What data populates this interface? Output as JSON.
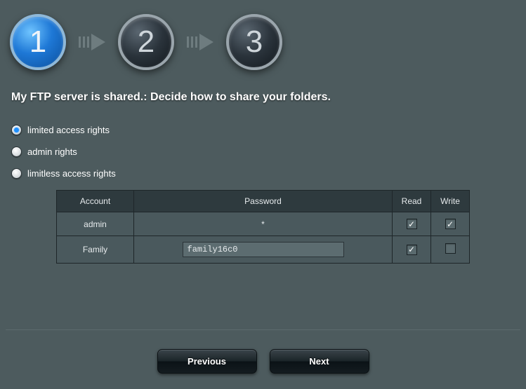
{
  "steps": {
    "s1": "1",
    "s2": "2",
    "s3": "3"
  },
  "heading": "My FTP server is shared.: Decide how to share your folders.",
  "radios": {
    "limited": "limited access rights",
    "admin": "admin rights",
    "limitless": "limitless access rights",
    "selected": "limited"
  },
  "table": {
    "headers": {
      "account": "Account",
      "password": "Password",
      "read": "Read",
      "write": "Write"
    },
    "rows": [
      {
        "account": "admin",
        "password_display": "*",
        "password_editable": false,
        "read": true,
        "write": true
      },
      {
        "account": "Family",
        "password_value": "family16c0",
        "password_editable": true,
        "read": true,
        "write": false
      }
    ]
  },
  "buttons": {
    "previous": "Previous",
    "next": "Next"
  }
}
